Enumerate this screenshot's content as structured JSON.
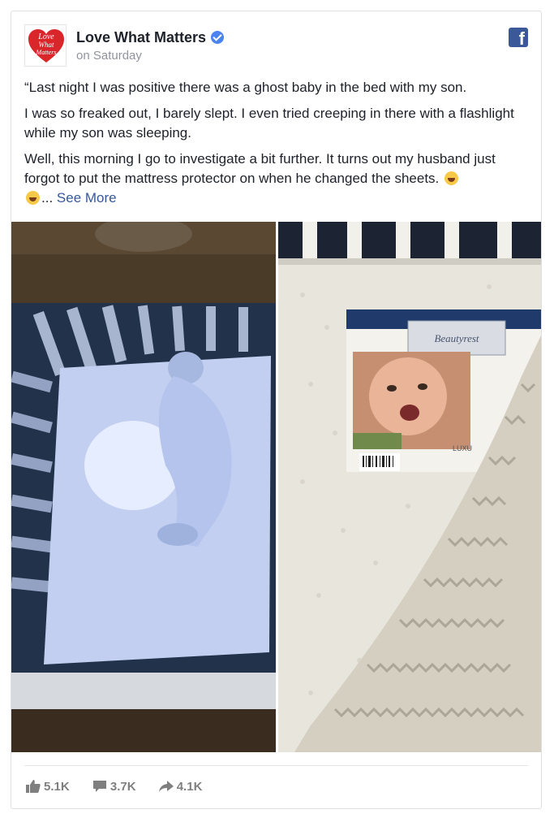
{
  "post": {
    "page_name": "Love What Matters",
    "timestamp": "on Saturday",
    "avatar_text": [
      "Love",
      "What",
      "Matters"
    ],
    "paragraphs": [
      "“Last night I was positive there was a ghost baby in the bed with my son.",
      "I was so freaked out, I barely slept. I even tried creeping in there with a flashlight while my son was sleeping.",
      "Well, this morning I go to investigate a bit further. It turns out my husband just forgot to put the mattress protector on when he changed the sheets."
    ],
    "ellipsis": "...",
    "see_more": "See More",
    "package_label": "Beautyrest",
    "package_corner": "LUXU"
  },
  "stats": {
    "likes": "5.1K",
    "comments": "3.7K",
    "shares": "4.1K"
  },
  "icons": {
    "verified": "verified-badge-icon",
    "facebook": "facebook-logo-icon",
    "like": "thumbs-up-icon",
    "comment": "comment-icon",
    "share": "share-arrow-icon",
    "emoji": "tears-of-joy-emoji"
  },
  "colors": {
    "link": "#365899",
    "facebook_blue": "#3b5998",
    "verified_blue": "#4b84f0"
  }
}
